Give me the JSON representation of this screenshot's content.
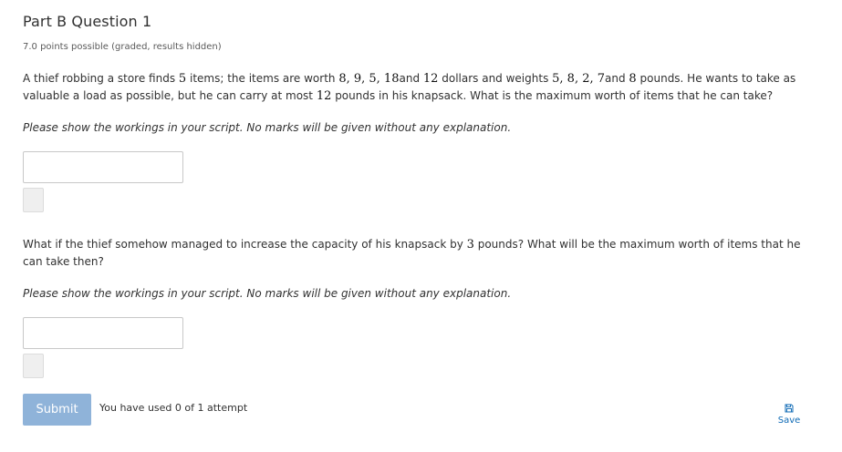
{
  "problem": {
    "title": "Part B Question 1",
    "points": "7.0 points possible (graded, results hidden)",
    "q1": {
      "t1": "A thief robbing a store finds ",
      "m1": "5",
      "t2": " items; the items are worth ",
      "m2": "8, 9, 5, 18",
      "t3": "and ",
      "m3": "12",
      "t4": " dollars and weights ",
      "m4": "5, 8, 2, 7",
      "t5": "and ",
      "m5": "8",
      "t6": " pounds. He wants to take as valuable a load as possible, but he can carry at most ",
      "m6": "12",
      "t7": " pounds in his knapsack. What is the maximum worth of items that he can take?"
    },
    "note": "Please show the workings in your script. No marks will be given without any explanation.",
    "q2": {
      "t1": "What if the thief somehow managed to increase the capacity of his knapsack by ",
      "m1": "3",
      "t2": " pounds? What will be the maximum worth of items that he can take then?"
    },
    "answer1": {
      "value": "",
      "placeholder": ""
    },
    "answer2": {
      "value": "",
      "placeholder": ""
    }
  },
  "actions": {
    "submit_label": "Submit",
    "attempts_text": "You have used 0 of 1 attempt",
    "save_label": "Save",
    "save_icon": "save-icon"
  },
  "colors": {
    "text": "#313131",
    "submit_bg": "#8fb3d9",
    "link": "#0e6ab5",
    "input_border": "#c8c8c8",
    "status_bg": "#efefef"
  }
}
